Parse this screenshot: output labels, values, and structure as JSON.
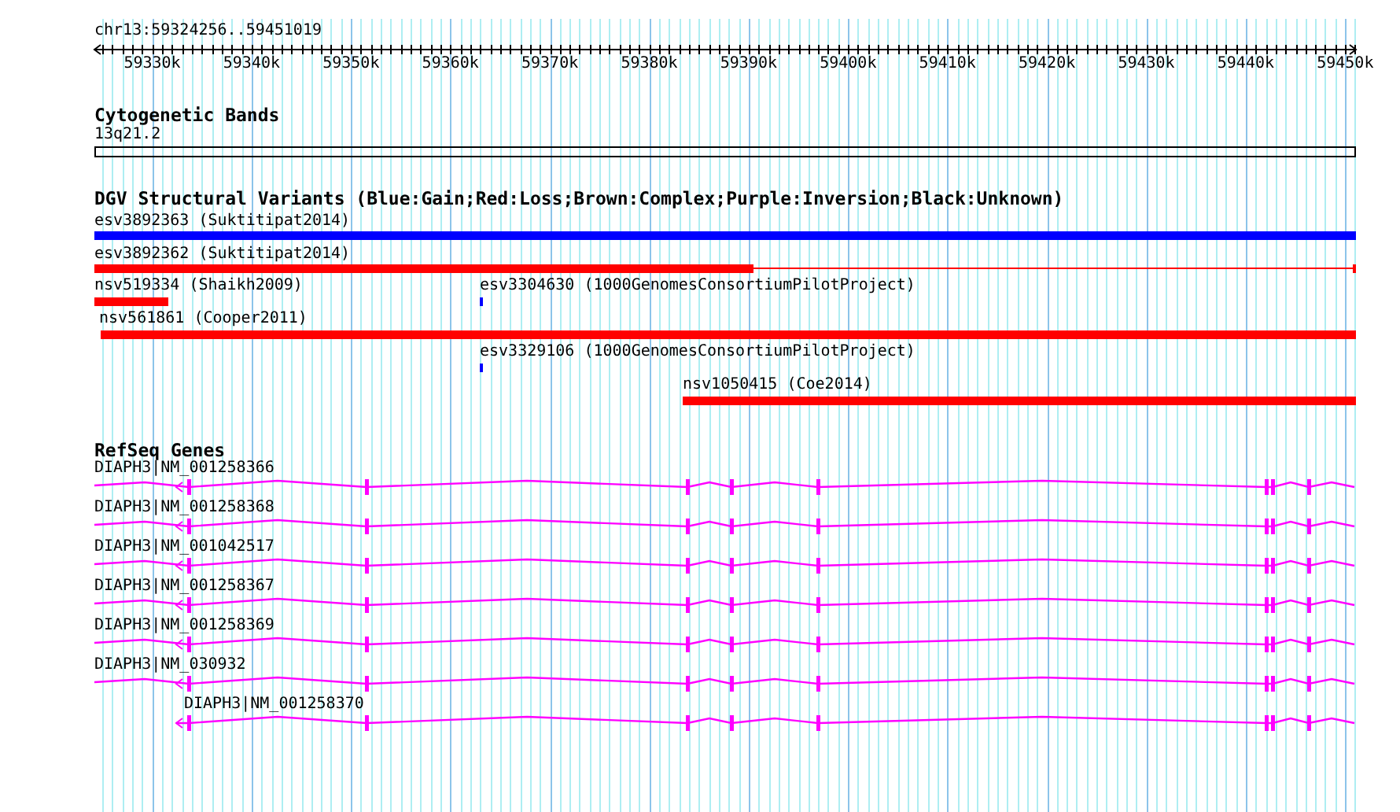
{
  "ruler": {
    "location": "chr13:59324256..59451019",
    "ticks": [
      "59330k",
      "59340k",
      "59350k",
      "59360k",
      "59370k",
      "59380k",
      "59390k",
      "59400k",
      "59410k",
      "59420k",
      "59430k",
      "59440k",
      "59450k"
    ]
  },
  "tracks": [
    {
      "kind": "cytoband",
      "title": "Cytogenetic Bands",
      "features": [
        {
          "label": "13q21.2"
        }
      ]
    },
    {
      "kind": "variants",
      "title": "DGV Structural Variants (Blue:Gain;Red:Loss;Brown:Complex;Purple:Inversion;Black:Unknown)",
      "features": [
        {
          "label": "esv3892363 (Suktitipat2014)",
          "color": "#0000ff"
        },
        {
          "label": "esv3892362 (Suktitipat2014)",
          "color": "#ff0000"
        },
        {
          "label": "nsv519334 (Shaikh2009)",
          "color": "#ff0000"
        },
        {
          "label": "esv3304630 (1000GenomesConsortiumPilotProject)",
          "color": "#0000ff"
        },
        {
          "label": "nsv561861 (Cooper2011)",
          "color": "#ff0000"
        },
        {
          "label": "esv3329106 (1000GenomesConsortiumPilotProject)",
          "color": "#0000ff"
        },
        {
          "label": "nsv1050415 (Coe2014)",
          "color": "#ff0000"
        }
      ]
    },
    {
      "kind": "genes",
      "title": "RefSeq Genes",
      "features": [
        {
          "label": "DIAPH3|NM_001258366"
        },
        {
          "label": "DIAPH3|NM_001258368"
        },
        {
          "label": "DIAPH3|NM_001042517"
        },
        {
          "label": "DIAPH3|NM_001258367"
        },
        {
          "label": "DIAPH3|NM_001258369"
        },
        {
          "label": "DIAPH3|NM_030932"
        },
        {
          "label": "DIAPH3|NM_001258370"
        }
      ]
    }
  ]
}
